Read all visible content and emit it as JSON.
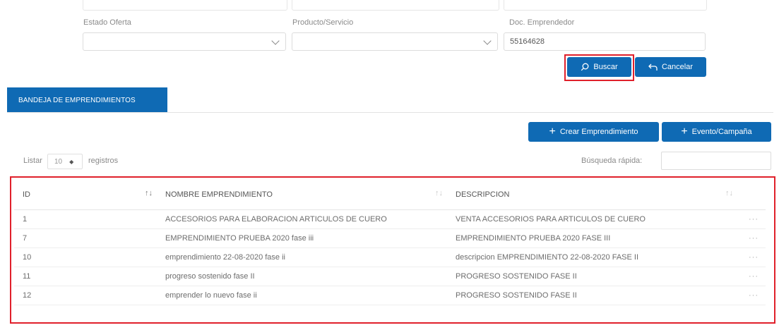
{
  "filters": {
    "estado_label": "Estado Oferta",
    "estado_value": "",
    "producto_label": "Producto/Servicio",
    "producto_value": "",
    "doc_label": "Doc. Emprendedor",
    "doc_value": "55164628"
  },
  "actions": {
    "buscar_label": "Buscar",
    "cancelar_label": "Cancelar"
  },
  "tab": {
    "label": "BANDEJA DE EMPRENDIMIENTOS"
  },
  "toolbar": {
    "crear_label": "Crear Emprendimiento",
    "evento_label": "Evento/Campaña"
  },
  "listing": {
    "listar_label": "Listar",
    "page_size": "10",
    "registros_label": "registros",
    "quick_search_label": "Búsqueda rápida:",
    "quick_search_value": ""
  },
  "table": {
    "headers": [
      "ID",
      "NOMBRE EMPRENDIMIENTO",
      "DESCRIPCION",
      ""
    ],
    "rows": [
      {
        "id": "1",
        "nombre": "ACCESORIOS PARA ELABORACION ARTICULOS DE CUERO",
        "descripcion": "VENTA ACCESORIOS PARA ARTICULOS DE CUERO",
        "menu": "···"
      },
      {
        "id": "7",
        "nombre": "EMPRENDIMIENTO PRUEBA 2020 fase iii",
        "descripcion": "EMPRENDIMIENTO PRUEBA 2020 FASE III",
        "menu": "···"
      },
      {
        "id": "10",
        "nombre": "emprendimiento 22-08-2020 fase ii",
        "descripcion": "descripcion EMPRENDIMIENTO 22-08-2020 FASE II",
        "menu": "···"
      },
      {
        "id": "11",
        "nombre": "progreso sostenido fase II",
        "descripcion": "PROGRESO SOSTENIDO FASE II",
        "menu": "···"
      },
      {
        "id": "12",
        "nombre": "emprender lo nuevo fase ii",
        "descripcion": "PROGRESO SOSTENIDO FASE II",
        "menu": "···"
      }
    ]
  },
  "colors": {
    "primary": "#0f6ab4",
    "highlight": "#e0202b"
  },
  "icons": {
    "buscar": "search-icon",
    "cancelar": "undo-arrow-icon",
    "crear": "plus-icon",
    "evento": "plus-icon"
  }
}
